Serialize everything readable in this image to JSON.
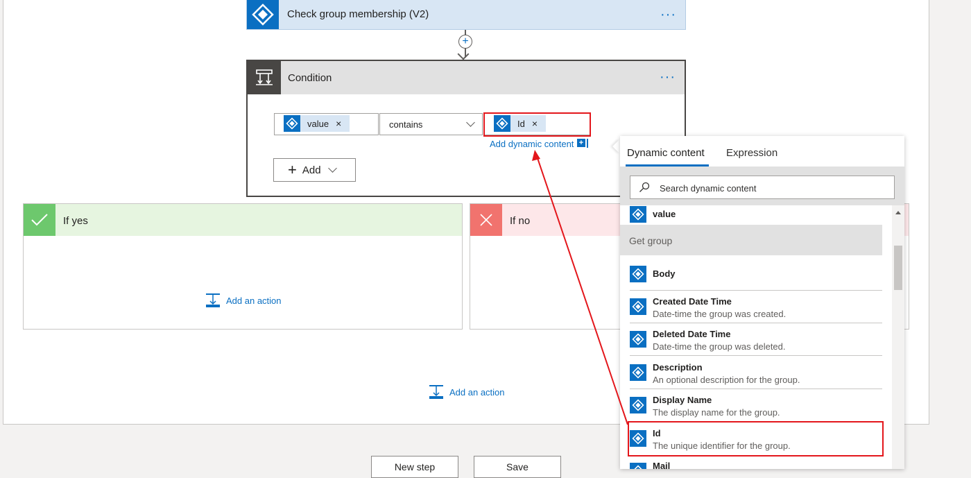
{
  "top_card": {
    "title": "Check group membership (V2)",
    "menu": "···"
  },
  "condition": {
    "title": "Condition",
    "menu": "···",
    "left_token": "value",
    "operator": "contains",
    "right_token": "Id",
    "remove_glyph": "×",
    "add_dynamic_content": "Add dynamic content",
    "add_button": "Add"
  },
  "if_yes": {
    "title": "If yes",
    "add_action": "Add an action"
  },
  "if_no": {
    "title": "If no"
  },
  "bottom_add_action": "Add an action",
  "footer": {
    "new_step": "New step",
    "save": "Save"
  },
  "dynamic_panel": {
    "tabs": [
      "Dynamic content",
      "Expression"
    ],
    "search_placeholder": "Search dynamic content",
    "top_item": "value",
    "group_title": "Get group",
    "items": [
      {
        "name": "Body",
        "desc": ""
      },
      {
        "name": "Created Date Time",
        "desc": "Date-time the group was created."
      },
      {
        "name": "Deleted Date Time",
        "desc": "Date-time the group was deleted."
      },
      {
        "name": "Description",
        "desc": "An optional description for the group."
      },
      {
        "name": "Display Name",
        "desc": "The display name for the group."
      },
      {
        "name": "Id",
        "desc": "The unique identifier for the group."
      },
      {
        "name": "Mail",
        "desc": ""
      }
    ]
  },
  "colors": {
    "accent": "#0a6fc2",
    "highlight": "#e3161b",
    "yes_header": "#e6f5e0",
    "yes_icon": "#6dc86d",
    "no_header": "#fde7e9",
    "no_icon": "#f1736e"
  }
}
